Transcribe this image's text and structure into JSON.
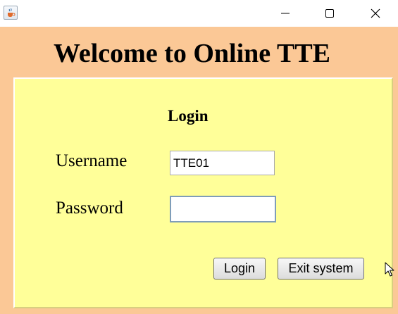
{
  "titlebar": {
    "app_icon": "java-coffee-cup-icon",
    "minimize_icon": "minimize-icon",
    "maximize_icon": "maximize-icon",
    "close_icon": "close-icon"
  },
  "header": {
    "title": "Welcome to Online TTE"
  },
  "login_panel": {
    "title": "Login",
    "username_label": "Username",
    "username_value": "TTE01",
    "password_label": "Password",
    "password_value": "",
    "login_button": "Login",
    "exit_button": "Exit system"
  },
  "colors": {
    "window_background": "#fbc896",
    "panel_background": "#ffff99"
  }
}
